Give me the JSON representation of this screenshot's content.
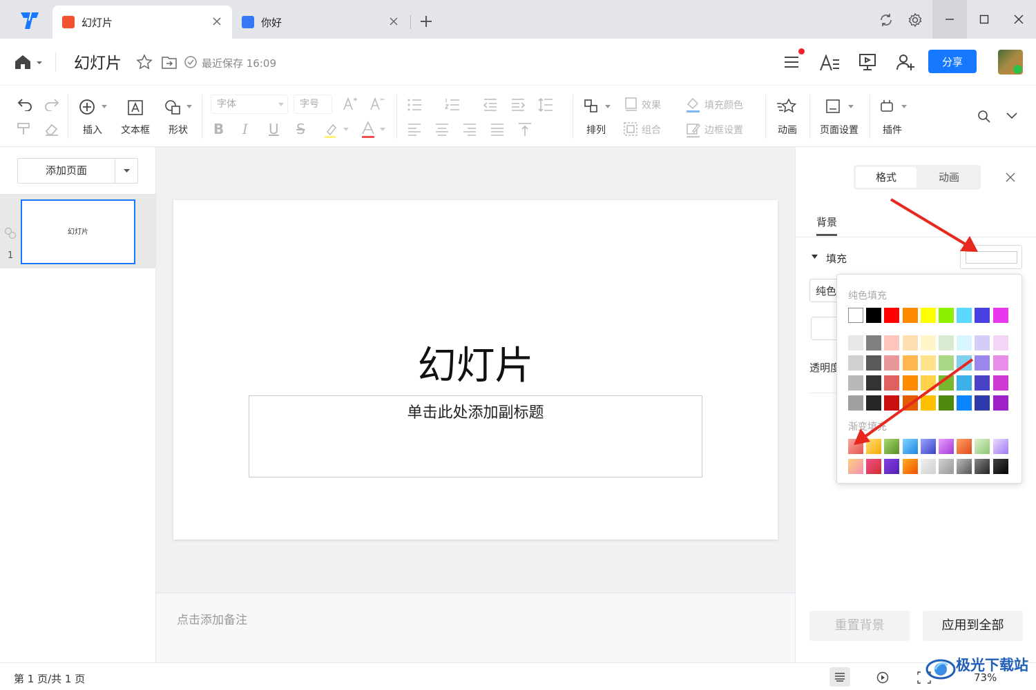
{
  "colors": {
    "accent": "#1677ff",
    "arrow": "#e8271e"
  },
  "tabs": [
    {
      "label": "幻灯片",
      "icon": "presentation-icon",
      "color": "#f2522e"
    },
    {
      "label": "你好",
      "icon": "document-icon",
      "color": "#3478f6"
    }
  ],
  "header": {
    "doc_title": "幻灯片",
    "save_status": "最近保存 16:09",
    "share_label": "分享"
  },
  "toolbar": {
    "insert": "插入",
    "textbox": "文本框",
    "shape": "形状",
    "font_placeholder": "字体",
    "size_placeholder": "字号",
    "arrange": "排列",
    "effect": "效果",
    "fill_color": "填充颜色",
    "group": "组合",
    "border": "边框设置",
    "animation": "动画",
    "page_setup": "页面设置",
    "plugin": "插件"
  },
  "left_panel": {
    "add_page": "添加页面",
    "thumb_text": "幻灯片",
    "slide_number": "1"
  },
  "slide": {
    "title": "幻灯片",
    "subtitle": "单击此处添加副标题"
  },
  "notes_placeholder": "点击添加备注",
  "right_panel": {
    "tab_format": "格式",
    "tab_animation": "动画",
    "section": "背景",
    "fill_label": "填充",
    "fill_type": "纯色",
    "opacity_label": "透明度",
    "reset_bg": "重置背景",
    "apply_all": "应用到全部"
  },
  "color_popup": {
    "solid_title": "纯色填充",
    "gradient_title": "渐变填充",
    "top_row": [
      "#ffffff",
      "#000000",
      "#ff0000",
      "#ff8a00",
      "#ffff00",
      "#8cf000",
      "#5ad8ff",
      "#4840e0",
      "#e838ee"
    ],
    "grid": [
      [
        "#e8e8e8",
        "#808080",
        "#ffc6bd",
        "#ffdfb0",
        "#fff5c7",
        "#d9ead2",
        "#d8f4fd",
        "#d4cdf7",
        "#f5d5f5"
      ],
      [
        "#d0d0d0",
        "#595959",
        "#e89898",
        "#ffb64c",
        "#ffe38a",
        "#a8d884",
        "#7fcfee",
        "#9a86ec",
        "#e68ee8"
      ],
      [
        "#b8b8b8",
        "#333333",
        "#e06060",
        "#ff8c00",
        "#ffd24a",
        "#79b82e",
        "#3db0e8",
        "#4a43c8",
        "#d03ad4"
      ],
      [
        "#a0a0a0",
        "#262626",
        "#c81010",
        "#e45c00",
        "#ffc000",
        "#4f8a10",
        "#0a84ff",
        "#2d3aa8",
        "#a020c8"
      ]
    ],
    "gradients": [
      [
        "linear-gradient(135deg,#f7a8a0,#e6534d)",
        "linear-gradient(135deg,#ffe07a,#f6a800)",
        "linear-gradient(135deg,#a8d870,#5a8e26)",
        "linear-gradient(135deg,#7fd4ff,#1d86e0)",
        "linear-gradient(135deg,#9aa6ff,#3a40c8)",
        "linear-gradient(135deg,#e8a0ff,#a23ad4)",
        "linear-gradient(135deg,#ffa060,#e04a20)",
        "linear-gradient(135deg,#dff0c8,#8cc878)",
        "linear-gradient(135deg,#eadcff,#a078f0)"
      ],
      [
        "linear-gradient(135deg,#ffd080,#f090b0)",
        "linear-gradient(135deg,#f0508a,#d03030)",
        "linear-gradient(135deg,#8840e0,#5020b0)",
        "linear-gradient(135deg,#ffb020,#f05000)",
        "linear-gradient(135deg,#f0f0f0,#d0d0d0)",
        "linear-gradient(135deg,#d0d0d0,#999999)",
        "linear-gradient(135deg,#bbbbbb,#555555)",
        "linear-gradient(135deg,#888888,#222222)",
        "linear-gradient(135deg,#444444,#000000)"
      ]
    ]
  },
  "status": {
    "page_info": "第 1 页/共 1 页",
    "zoom": "73%"
  },
  "watermark": "极光下载站"
}
